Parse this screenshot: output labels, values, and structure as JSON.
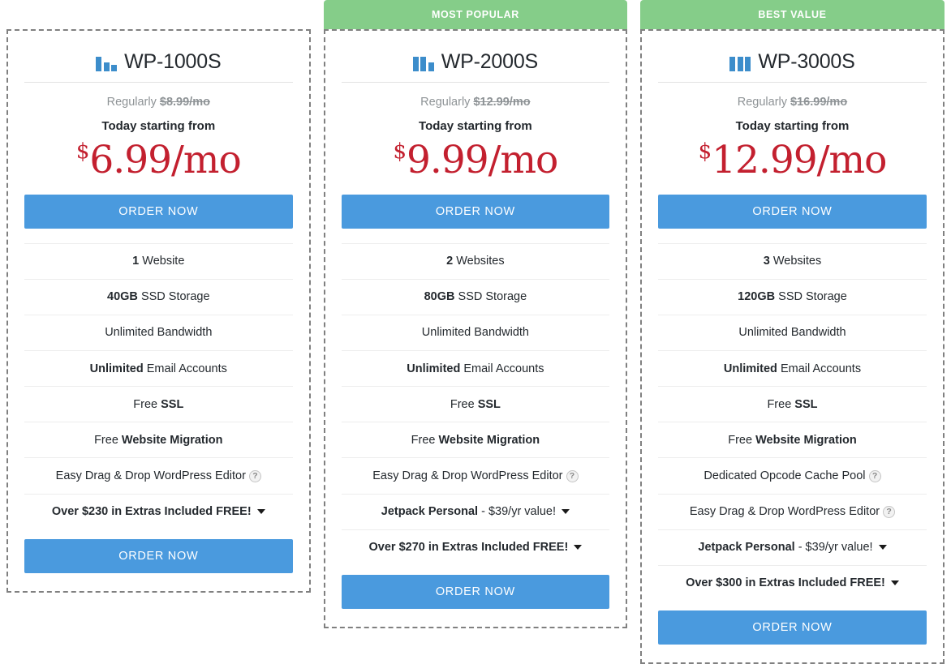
{
  "plans": [
    {
      "ribbon": "",
      "has_ribbon": false,
      "icon": "bar-chart-1-icon",
      "name": "WP-1000S",
      "regular_prefix": "Regularly",
      "regular_price": "$8.99/mo",
      "today_label": "Today starting from",
      "price_currency": "$",
      "price_amount": "6.99/mo",
      "order_label_top": "ORDER NOW",
      "order_label_bottom": "ORDER NOW",
      "features": [
        {
          "bold": "1",
          "text": "Website"
        },
        {
          "bold": "40GB",
          "text": "SSD Storage"
        },
        {
          "bold": "",
          "text": "Unlimited Bandwidth"
        },
        {
          "bold": "Unlimited",
          "text": "Email Accounts"
        },
        {
          "bold": "",
          "text": "Free ",
          "bold_after": "SSL"
        },
        {
          "bold": "",
          "text": "Free ",
          "bold_after": "Website Migration"
        },
        {
          "bold": "",
          "text": "Easy Drag & Drop WordPress Editor",
          "help": "?"
        },
        {
          "bold": "",
          "text": "Over $230 in Extras Included FREE!",
          "caret": true,
          "all_bold": true
        }
      ]
    },
    {
      "ribbon": "MOST POPULAR",
      "has_ribbon": true,
      "icon": "bar-chart-2-icon",
      "name": "WP-2000S",
      "regular_prefix": "Regularly",
      "regular_price": "$12.99/mo",
      "today_label": "Today starting from",
      "price_currency": "$",
      "price_amount": "9.99/mo",
      "order_label_top": "ORDER NOW",
      "order_label_bottom": "ORDER NOW",
      "features": [
        {
          "bold": "2",
          "text": "Websites"
        },
        {
          "bold": "80GB",
          "text": "SSD Storage"
        },
        {
          "bold": "",
          "text": "Unlimited Bandwidth"
        },
        {
          "bold": "Unlimited",
          "text": "Email Accounts"
        },
        {
          "bold": "",
          "text": "Free ",
          "bold_after": "SSL"
        },
        {
          "bold": "",
          "text": "Free ",
          "bold_after": "Website Migration"
        },
        {
          "bold": "",
          "text": "Easy Drag & Drop WordPress Editor",
          "help": "?"
        },
        {
          "bold": "Jetpack Personal",
          "text": "- $39/yr value!",
          "caret": true
        },
        {
          "bold": "",
          "text": "Over $270 in Extras Included FREE!",
          "caret": true,
          "all_bold": true
        }
      ]
    },
    {
      "ribbon": "BEST VALUE",
      "has_ribbon": true,
      "icon": "bar-chart-3-icon",
      "name": "WP-3000S",
      "regular_prefix": "Regularly",
      "regular_price": "$16.99/mo",
      "today_label": "Today starting from",
      "price_currency": "$",
      "price_amount": "12.99/mo",
      "order_label_top": "ORDER NOW",
      "order_label_bottom": "ORDER NOW",
      "features": [
        {
          "bold": "3",
          "text": "Websites"
        },
        {
          "bold": "120GB",
          "text": "SSD Storage"
        },
        {
          "bold": "",
          "text": "Unlimited Bandwidth"
        },
        {
          "bold": "Unlimited",
          "text": "Email Accounts"
        },
        {
          "bold": "",
          "text": "Free ",
          "bold_after": "SSL"
        },
        {
          "bold": "",
          "text": "Free ",
          "bold_after": "Website Migration"
        },
        {
          "bold": "",
          "text": "Dedicated Opcode Cache Pool",
          "help": "?"
        },
        {
          "bold": "",
          "text": "Easy Drag & Drop WordPress Editor",
          "help": "?"
        },
        {
          "bold": "Jetpack Personal",
          "text": "- $39/yr value!",
          "caret": true
        },
        {
          "bold": "",
          "text": "Over $300 in Extras Included FREE!",
          "caret": true,
          "all_bold": true
        }
      ]
    }
  ],
  "colors": {
    "ribbon_green": "#85cd89",
    "button_blue": "#4a9ade",
    "price_red": "#c3202f",
    "icon_blue": "#3c8dcb",
    "muted_gray": "#8e9396",
    "border_dash": "#808080"
  },
  "icon_bar_heights": {
    "bar-chart-1-icon": [
      18,
      11,
      8
    ],
    "bar-chart-2-icon": [
      18,
      18,
      11
    ],
    "bar-chart-3-icon": [
      18,
      18,
      18
    ]
  }
}
